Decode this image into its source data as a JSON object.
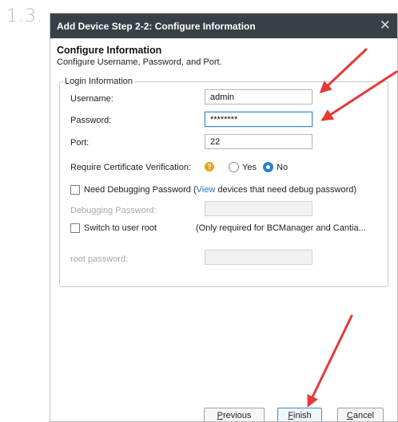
{
  "step_number": "1.3.",
  "dialog": {
    "title": "Add Device Step 2-2: Configure Information",
    "close_glyph": "✕",
    "section_title": "Configure Information",
    "section_description": "Configure Username, Password, and Port."
  },
  "login": {
    "legend": "Login Information",
    "username_label": "Username:",
    "username_value": "admin",
    "password_label": "Password:",
    "password_value": "********",
    "port_label": "Port:",
    "port_value": "22",
    "cert_label": "Require Certificate Verification:",
    "cert_help_glyph": "?",
    "cert_yes_label": "Yes",
    "cert_no_label": "No",
    "cert_selected": "No",
    "debug_prefix": "Need Debugging Password (",
    "debug_link": "View",
    "debug_suffix": " devices that need debug password)",
    "debug_password_label": "Debugging Password:",
    "switch_root_label": "Switch to user root",
    "switch_root_note": "(Only required for BCManager and Cantia...",
    "root_password_label": "root password:"
  },
  "footer": {
    "previous_mnemonic": "P",
    "previous_rest": "revious",
    "finish_mnemonic": "F",
    "finish_rest": "inish",
    "cancel_mnemonic": "C",
    "cancel_rest": "ancel"
  },
  "colors": {
    "titlebar": "#3a3f47",
    "accent": "#2a7fd4",
    "annotation_arrow": "#e53935",
    "help_icon": "#e8a317"
  }
}
